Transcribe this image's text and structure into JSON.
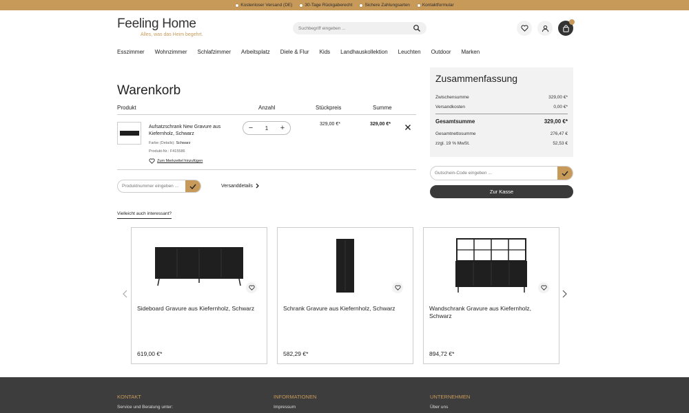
{
  "topbar": {
    "usps": [
      "Kostenloser Versand (DE)",
      "30-Tage Rückgaberecht",
      "Sichere Zahlungsarten",
      "Kontaktformular"
    ]
  },
  "header": {
    "logo_text": "Feeling Home",
    "tagline": "Alles, was das Heim begehrt.",
    "search_placeholder": "Suchbegriff eingeben ..."
  },
  "nav": {
    "items": [
      "Esszimmer",
      "Wohnzimmer",
      "Schlafzimmer",
      "Arbeitsplatz",
      "Diele & Flur",
      "Kids",
      "Landhauskollektion",
      "Leuchten",
      "Outdoor",
      "Marken"
    ]
  },
  "cart": {
    "title": "Warenkorb",
    "headers": {
      "product": "Produkt",
      "qty": "Anzahl",
      "unit": "Stückpreis",
      "sum": "Summe"
    },
    "item": {
      "name": "Aufsatzschrank New Gravure aus Kiefernholz, Schwarz",
      "color_label": "Farbe (Details):",
      "color_value": "Schwarz",
      "product_no": "Produkt-Nr.: F415586",
      "wishlist": "Zum Merkzettel hinzufügen",
      "qty": "1",
      "unit_price": "329,00 €*",
      "sum": "329,00 €*"
    },
    "productnumber_placeholder": "Produktnummer eingeben ...",
    "shipping_details": "Versanddetails",
    "also_interesting": "Vielleicht auch interessant?"
  },
  "summary": {
    "title": "Zusammenfassung",
    "subtotal_label": "Zwischensumme",
    "subtotal": "329,00 €*",
    "shipping_label": "Versandkosten",
    "shipping": "0,00 €*",
    "total_label": "Gesamtsumme",
    "total": "329,00 €*",
    "net_label": "Gesamtnettosumme",
    "net": "276,47 €",
    "vat_label": "zzgl. 19 % MwSt.",
    "vat": "52,53 €",
    "coupon_placeholder": "Gutschein-Code eingeben ...",
    "checkout": "Zur Kasse"
  },
  "products": [
    {
      "name": "Sideboard Gravure aus Kiefernholz, Schwarz",
      "price": "619,00 €*"
    },
    {
      "name": "Schrank Gravure aus Kiefernholz, Schwarz",
      "price": "582,29 €*"
    },
    {
      "name": "Wandschrank Gravure aus Kiefernholz, Schwarz",
      "price": "894,72 €*"
    }
  ],
  "footer": {
    "contact_head": "KONTAKT",
    "contact_text": "Service und Beratung unter:",
    "info_head": "INFORMATIONEN",
    "info_text": "Impressum",
    "company_head": "UNTERNEHMEN",
    "company_text": "Über uns"
  },
  "colors": {
    "accent": "#c89a5a",
    "dark": "#3a3a3a",
    "footer": "#3d3d3d"
  }
}
